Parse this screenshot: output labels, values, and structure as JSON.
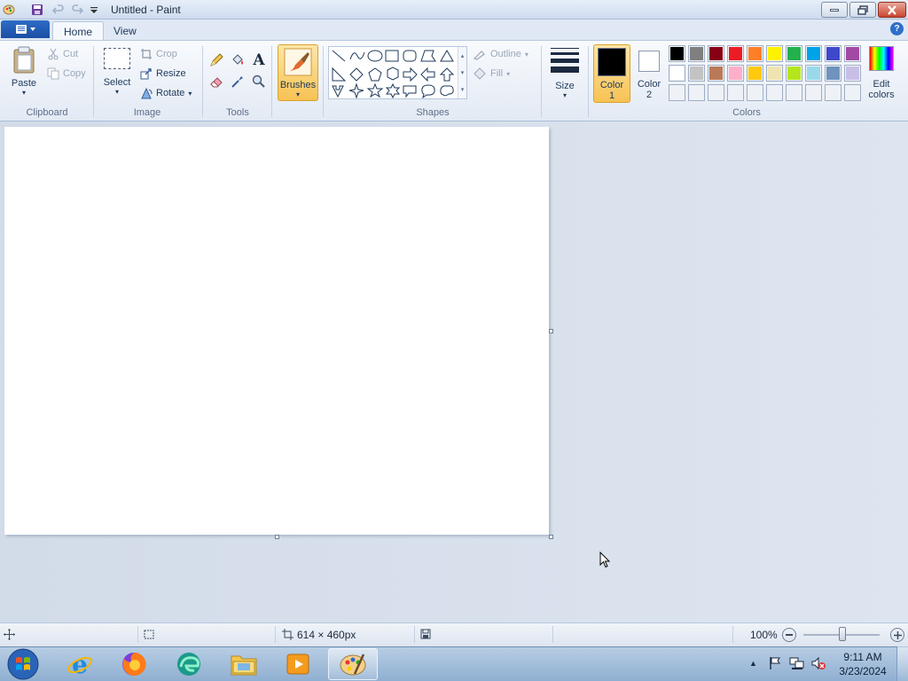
{
  "window": {
    "title": "Untitled - Paint",
    "controls": {
      "minimize": "minimize",
      "maximize": "restore",
      "close": "close"
    }
  },
  "quick_access": {
    "icons": [
      "paint-app-icon",
      "save-icon",
      "undo-icon",
      "redo-icon",
      "customize-qat-icon"
    ]
  },
  "tabs": {
    "file_menu_icon": "menu-icon",
    "home": "Home",
    "view": "View",
    "active": "Home"
  },
  "ribbon": {
    "clipboard": {
      "label": "Clipboard",
      "paste": "Paste",
      "cut": "Cut",
      "copy": "Copy"
    },
    "image": {
      "label": "Image",
      "select": "Select",
      "crop": "Crop",
      "resize": "Resize",
      "rotate": "Rotate"
    },
    "tools": {
      "label": "Tools",
      "items": [
        "pencil-icon",
        "fill-bucket-icon",
        "text-icon",
        "eraser-icon",
        "color-picker-icon",
        "magnifier-icon"
      ]
    },
    "brushes": {
      "label": "Brushes"
    },
    "shapes": {
      "label": "Shapes",
      "outline": "Outline",
      "fill": "Fill"
    },
    "size": {
      "label": "Size"
    },
    "colors": {
      "label": "Colors",
      "color1_line1": "Color",
      "color1_line2": "1",
      "color2_line1": "Color",
      "color2_line2": "2",
      "edit_line1": "Edit",
      "edit_line2": "colors",
      "color1_value": "#000000",
      "color2_value": "#ffffff",
      "palette_row1": [
        "#000000",
        "#7f7f7f",
        "#880015",
        "#ed1c24",
        "#ff7f27",
        "#fff200",
        "#22b14c",
        "#00a2e8",
        "#3f48cc",
        "#a349a4"
      ],
      "palette_row2": [
        "#ffffff",
        "#c3c3c3",
        "#b97a57",
        "#ffaec9",
        "#ffc90e",
        "#efe4b0",
        "#b5e61d",
        "#99d9ea",
        "#7092be",
        "#c8bfe7"
      ],
      "palette_row3": [
        "",
        "",
        "",
        "",
        "",
        "",
        "",
        "",
        "",
        ""
      ]
    }
  },
  "status": {
    "canvas_size": "614 × 460px",
    "zoom": "100%"
  },
  "taskbar": {
    "apps": [
      "start-button",
      "internet-explorer-icon",
      "firefox-icon",
      "edge-icon",
      "file-explorer-icon",
      "media-player-icon",
      "paint-icon"
    ],
    "time": "9:11 AM",
    "date": "3/23/2024"
  }
}
